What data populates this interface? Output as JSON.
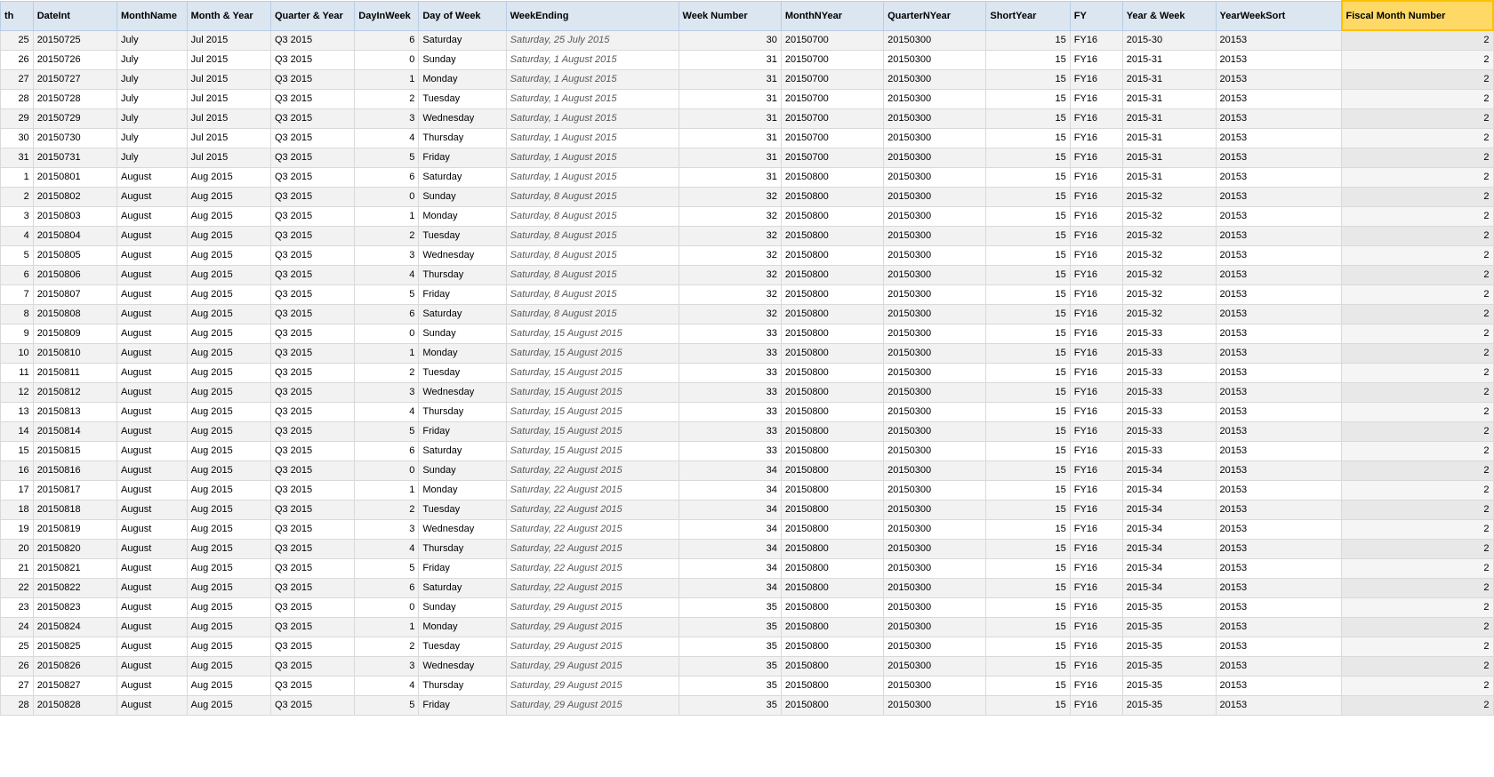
{
  "columns": [
    {
      "key": "row",
      "label": "th",
      "class": "col-row"
    },
    {
      "key": "dateint",
      "label": "DateInt",
      "class": "col-date"
    },
    {
      "key": "monthname",
      "label": "MonthName",
      "class": "col-month"
    },
    {
      "key": "monthyear",
      "label": "Month & Year",
      "class": "col-monthyear"
    },
    {
      "key": "quarteryear",
      "label": "Quarter & Year",
      "class": "col-quarter"
    },
    {
      "key": "dayinweek",
      "label": "DayInWeek",
      "class": "col-dayin"
    },
    {
      "key": "dayofweek",
      "label": "Day of Week",
      "class": "col-dow"
    },
    {
      "key": "weekending",
      "label": "WeekEnding",
      "class": "col-weekend"
    },
    {
      "key": "weeknumber",
      "label": "Week Number",
      "class": "col-weeknum"
    },
    {
      "key": "monthnyear",
      "label": "MonthNYear",
      "class": "col-monthyr"
    },
    {
      "key": "quarternyr",
      "label": "QuarterNYear",
      "class": "col-qtryr"
    },
    {
      "key": "shortyear",
      "label": "ShortYear",
      "class": "col-shortyear"
    },
    {
      "key": "fy",
      "label": "FY",
      "class": "col-fy"
    },
    {
      "key": "yearweek",
      "label": "Year & Week",
      "class": "col-yearweek"
    },
    {
      "key": "yearweeksort",
      "label": "YearWeekSort",
      "class": "col-yearweeksort"
    },
    {
      "key": "fiscalmonth",
      "label": "Fiscal Month Number",
      "class": "col-fiscalmonth",
      "highlighted": true
    }
  ],
  "rows": [
    {
      "row": 25,
      "dateint": "20150725",
      "monthname": "July",
      "monthyear": "Jul 2015",
      "quarteryear": "Q3 2015",
      "dayinweek": 6,
      "dayofweek": "Saturday",
      "weekending": "Saturday, 25 July 2015",
      "weeknumber": 30,
      "monthnyear": "20150700",
      "quarternyr": "20150300",
      "shortyear": 15,
      "fy": "FY16",
      "yearweek": "2015-30",
      "yearweeksort": "20153",
      "fiscalmonth": 2
    },
    {
      "row": 26,
      "dateint": "20150726",
      "monthname": "July",
      "monthyear": "Jul 2015",
      "quarteryear": "Q3 2015",
      "dayinweek": 0,
      "dayofweek": "Sunday",
      "weekending": "Saturday, 1 August 2015",
      "weeknumber": 31,
      "monthnyear": "20150700",
      "quarternyr": "20150300",
      "shortyear": 15,
      "fy": "FY16",
      "yearweek": "2015-31",
      "yearweeksort": "20153",
      "fiscalmonth": 2
    },
    {
      "row": 27,
      "dateint": "20150727",
      "monthname": "July",
      "monthyear": "Jul 2015",
      "quarteryear": "Q3 2015",
      "dayinweek": 1,
      "dayofweek": "Monday",
      "weekending": "Saturday, 1 August 2015",
      "weeknumber": 31,
      "monthnyear": "20150700",
      "quarternyr": "20150300",
      "shortyear": 15,
      "fy": "FY16",
      "yearweek": "2015-31",
      "yearweeksort": "20153",
      "fiscalmonth": 2
    },
    {
      "row": 28,
      "dateint": "20150728",
      "monthname": "July",
      "monthyear": "Jul 2015",
      "quarteryear": "Q3 2015",
      "dayinweek": 2,
      "dayofweek": "Tuesday",
      "weekending": "Saturday, 1 August 2015",
      "weeknumber": 31,
      "monthnyear": "20150700",
      "quarternyr": "20150300",
      "shortyear": 15,
      "fy": "FY16",
      "yearweek": "2015-31",
      "yearweeksort": "20153",
      "fiscalmonth": 2
    },
    {
      "row": 29,
      "dateint": "20150729",
      "monthname": "July",
      "monthyear": "Jul 2015",
      "quarteryear": "Q3 2015",
      "dayinweek": 3,
      "dayofweek": "Wednesday",
      "weekending": "Saturday, 1 August 2015",
      "weeknumber": 31,
      "monthnyear": "20150700",
      "quarternyr": "20150300",
      "shortyear": 15,
      "fy": "FY16",
      "yearweek": "2015-31",
      "yearweeksort": "20153",
      "fiscalmonth": 2
    },
    {
      "row": 30,
      "dateint": "20150730",
      "monthname": "July",
      "monthyear": "Jul 2015",
      "quarteryear": "Q3 2015",
      "dayinweek": 4,
      "dayofweek": "Thursday",
      "weekending": "Saturday, 1 August 2015",
      "weeknumber": 31,
      "monthnyear": "20150700",
      "quarternyr": "20150300",
      "shortyear": 15,
      "fy": "FY16",
      "yearweek": "2015-31",
      "yearweeksort": "20153",
      "fiscalmonth": 2
    },
    {
      "row": 31,
      "dateint": "20150731",
      "monthname": "July",
      "monthyear": "Jul 2015",
      "quarteryear": "Q3 2015",
      "dayinweek": 5,
      "dayofweek": "Friday",
      "weekending": "Saturday, 1 August 2015",
      "weeknumber": 31,
      "monthnyear": "20150700",
      "quarternyr": "20150300",
      "shortyear": 15,
      "fy": "FY16",
      "yearweek": "2015-31",
      "yearweeksort": "20153",
      "fiscalmonth": 2
    },
    {
      "row": 1,
      "dateint": "20150801",
      "monthname": "August",
      "monthyear": "Aug 2015",
      "quarteryear": "Q3 2015",
      "dayinweek": 6,
      "dayofweek": "Saturday",
      "weekending": "Saturday, 1 August 2015",
      "weeknumber": 31,
      "monthnyear": "20150800",
      "quarternyr": "20150300",
      "shortyear": 15,
      "fy": "FY16",
      "yearweek": "2015-31",
      "yearweeksort": "20153",
      "fiscalmonth": 2
    },
    {
      "row": 2,
      "dateint": "20150802",
      "monthname": "August",
      "monthyear": "Aug 2015",
      "quarteryear": "Q3 2015",
      "dayinweek": 0,
      "dayofweek": "Sunday",
      "weekending": "Saturday, 8 August 2015",
      "weeknumber": 32,
      "monthnyear": "20150800",
      "quarternyr": "20150300",
      "shortyear": 15,
      "fy": "FY16",
      "yearweek": "2015-32",
      "yearweeksort": "20153",
      "fiscalmonth": 2
    },
    {
      "row": 3,
      "dateint": "20150803",
      "monthname": "August",
      "monthyear": "Aug 2015",
      "quarteryear": "Q3 2015",
      "dayinweek": 1,
      "dayofweek": "Monday",
      "weekending": "Saturday, 8 August 2015",
      "weeknumber": 32,
      "monthnyear": "20150800",
      "quarternyr": "20150300",
      "shortyear": 15,
      "fy": "FY16",
      "yearweek": "2015-32",
      "yearweeksort": "20153",
      "fiscalmonth": 2
    },
    {
      "row": 4,
      "dateint": "20150804",
      "monthname": "August",
      "monthyear": "Aug 2015",
      "quarteryear": "Q3 2015",
      "dayinweek": 2,
      "dayofweek": "Tuesday",
      "weekending": "Saturday, 8 August 2015",
      "weeknumber": 32,
      "monthnyear": "20150800",
      "quarternyr": "20150300",
      "shortyear": 15,
      "fy": "FY16",
      "yearweek": "2015-32",
      "yearweeksort": "20153",
      "fiscalmonth": 2
    },
    {
      "row": 5,
      "dateint": "20150805",
      "monthname": "August",
      "monthyear": "Aug 2015",
      "quarteryear": "Q3 2015",
      "dayinweek": 3,
      "dayofweek": "Wednesday",
      "weekending": "Saturday, 8 August 2015",
      "weeknumber": 32,
      "monthnyear": "20150800",
      "quarternyr": "20150300",
      "shortyear": 15,
      "fy": "FY16",
      "yearweek": "2015-32",
      "yearweeksort": "20153",
      "fiscalmonth": 2
    },
    {
      "row": 6,
      "dateint": "20150806",
      "monthname": "August",
      "monthyear": "Aug 2015",
      "quarteryear": "Q3 2015",
      "dayinweek": 4,
      "dayofweek": "Thursday",
      "weekending": "Saturday, 8 August 2015",
      "weeknumber": 32,
      "monthnyear": "20150800",
      "quarternyr": "20150300",
      "shortyear": 15,
      "fy": "FY16",
      "yearweek": "2015-32",
      "yearweeksort": "20153",
      "fiscalmonth": 2
    },
    {
      "row": 7,
      "dateint": "20150807",
      "monthname": "August",
      "monthyear": "Aug 2015",
      "quarteryear": "Q3 2015",
      "dayinweek": 5,
      "dayofweek": "Friday",
      "weekending": "Saturday, 8 August 2015",
      "weeknumber": 32,
      "monthnyear": "20150800",
      "quarternyr": "20150300",
      "shortyear": 15,
      "fy": "FY16",
      "yearweek": "2015-32",
      "yearweeksort": "20153",
      "fiscalmonth": 2
    },
    {
      "row": 8,
      "dateint": "20150808",
      "monthname": "August",
      "monthyear": "Aug 2015",
      "quarteryear": "Q3 2015",
      "dayinweek": 6,
      "dayofweek": "Saturday",
      "weekending": "Saturday, 8 August 2015",
      "weeknumber": 32,
      "monthnyear": "20150800",
      "quarternyr": "20150300",
      "shortyear": 15,
      "fy": "FY16",
      "yearweek": "2015-32",
      "yearweeksort": "20153",
      "fiscalmonth": 2
    },
    {
      "row": 9,
      "dateint": "20150809",
      "monthname": "August",
      "monthyear": "Aug 2015",
      "quarteryear": "Q3 2015",
      "dayinweek": 0,
      "dayofweek": "Sunday",
      "weekending": "Saturday, 15 August 2015",
      "weeknumber": 33,
      "monthnyear": "20150800",
      "quarternyr": "20150300",
      "shortyear": 15,
      "fy": "FY16",
      "yearweek": "2015-33",
      "yearweeksort": "20153",
      "fiscalmonth": 2
    },
    {
      "row": 10,
      "dateint": "20150810",
      "monthname": "August",
      "monthyear": "Aug 2015",
      "quarteryear": "Q3 2015",
      "dayinweek": 1,
      "dayofweek": "Monday",
      "weekending": "Saturday, 15 August 2015",
      "weeknumber": 33,
      "monthnyear": "20150800",
      "quarternyr": "20150300",
      "shortyear": 15,
      "fy": "FY16",
      "yearweek": "2015-33",
      "yearweeksort": "20153",
      "fiscalmonth": 2
    },
    {
      "row": 11,
      "dateint": "20150811",
      "monthname": "August",
      "monthyear": "Aug 2015",
      "quarteryear": "Q3 2015",
      "dayinweek": 2,
      "dayofweek": "Tuesday",
      "weekending": "Saturday, 15 August 2015",
      "weeknumber": 33,
      "monthnyear": "20150800",
      "quarternyr": "20150300",
      "shortyear": 15,
      "fy": "FY16",
      "yearweek": "2015-33",
      "yearweeksort": "20153",
      "fiscalmonth": 2
    },
    {
      "row": 12,
      "dateint": "20150812",
      "monthname": "August",
      "monthyear": "Aug 2015",
      "quarteryear": "Q3 2015",
      "dayinweek": 3,
      "dayofweek": "Wednesday",
      "weekending": "Saturday, 15 August 2015",
      "weeknumber": 33,
      "monthnyear": "20150800",
      "quarternyr": "20150300",
      "shortyear": 15,
      "fy": "FY16",
      "yearweek": "2015-33",
      "yearweeksort": "20153",
      "fiscalmonth": 2
    },
    {
      "row": 13,
      "dateint": "20150813",
      "monthname": "August",
      "monthyear": "Aug 2015",
      "quarteryear": "Q3 2015",
      "dayinweek": 4,
      "dayofweek": "Thursday",
      "weekending": "Saturday, 15 August 2015",
      "weeknumber": 33,
      "monthnyear": "20150800",
      "quarternyr": "20150300",
      "shortyear": 15,
      "fy": "FY16",
      "yearweek": "2015-33",
      "yearweeksort": "20153",
      "fiscalmonth": 2
    },
    {
      "row": 14,
      "dateint": "20150814",
      "monthname": "August",
      "monthyear": "Aug 2015",
      "quarteryear": "Q3 2015",
      "dayinweek": 5,
      "dayofweek": "Friday",
      "weekending": "Saturday, 15 August 2015",
      "weeknumber": 33,
      "monthnyear": "20150800",
      "quarternyr": "20150300",
      "shortyear": 15,
      "fy": "FY16",
      "yearweek": "2015-33",
      "yearweeksort": "20153",
      "fiscalmonth": 2
    },
    {
      "row": 15,
      "dateint": "20150815",
      "monthname": "August",
      "monthyear": "Aug 2015",
      "quarteryear": "Q3 2015",
      "dayinweek": 6,
      "dayofweek": "Saturday",
      "weekending": "Saturday, 15 August 2015",
      "weeknumber": 33,
      "monthnyear": "20150800",
      "quarternyr": "20150300",
      "shortyear": 15,
      "fy": "FY16",
      "yearweek": "2015-33",
      "yearweeksort": "20153",
      "fiscalmonth": 2
    },
    {
      "row": 16,
      "dateint": "20150816",
      "monthname": "August",
      "monthyear": "Aug 2015",
      "quarteryear": "Q3 2015",
      "dayinweek": 0,
      "dayofweek": "Sunday",
      "weekending": "Saturday, 22 August 2015",
      "weeknumber": 34,
      "monthnyear": "20150800",
      "quarternyr": "20150300",
      "shortyear": 15,
      "fy": "FY16",
      "yearweek": "2015-34",
      "yearweeksort": "20153",
      "fiscalmonth": 2
    },
    {
      "row": 17,
      "dateint": "20150817",
      "monthname": "August",
      "monthyear": "Aug 2015",
      "quarteryear": "Q3 2015",
      "dayinweek": 1,
      "dayofweek": "Monday",
      "weekending": "Saturday, 22 August 2015",
      "weeknumber": 34,
      "monthnyear": "20150800",
      "quarternyr": "20150300",
      "shortyear": 15,
      "fy": "FY16",
      "yearweek": "2015-34",
      "yearweeksort": "20153",
      "fiscalmonth": 2
    },
    {
      "row": 18,
      "dateint": "20150818",
      "monthname": "August",
      "monthyear": "Aug 2015",
      "quarteryear": "Q3 2015",
      "dayinweek": 2,
      "dayofweek": "Tuesday",
      "weekending": "Saturday, 22 August 2015",
      "weeknumber": 34,
      "monthnyear": "20150800",
      "quarternyr": "20150300",
      "shortyear": 15,
      "fy": "FY16",
      "yearweek": "2015-34",
      "yearweeksort": "20153",
      "fiscalmonth": 2
    },
    {
      "row": 19,
      "dateint": "20150819",
      "monthname": "August",
      "monthyear": "Aug 2015",
      "quarteryear": "Q3 2015",
      "dayinweek": 3,
      "dayofweek": "Wednesday",
      "weekending": "Saturday, 22 August 2015",
      "weeknumber": 34,
      "monthnyear": "20150800",
      "quarternyr": "20150300",
      "shortyear": 15,
      "fy": "FY16",
      "yearweek": "2015-34",
      "yearweeksort": "20153",
      "fiscalmonth": 2
    },
    {
      "row": 20,
      "dateint": "20150820",
      "monthname": "August",
      "monthyear": "Aug 2015",
      "quarteryear": "Q3 2015",
      "dayinweek": 4,
      "dayofweek": "Thursday",
      "weekending": "Saturday, 22 August 2015",
      "weeknumber": 34,
      "monthnyear": "20150800",
      "quarternyr": "20150300",
      "shortyear": 15,
      "fy": "FY16",
      "yearweek": "2015-34",
      "yearweeksort": "20153",
      "fiscalmonth": 2
    },
    {
      "row": 21,
      "dateint": "20150821",
      "monthname": "August",
      "monthyear": "Aug 2015",
      "quarteryear": "Q3 2015",
      "dayinweek": 5,
      "dayofweek": "Friday",
      "weekending": "Saturday, 22 August 2015",
      "weeknumber": 34,
      "monthnyear": "20150800",
      "quarternyr": "20150300",
      "shortyear": 15,
      "fy": "FY16",
      "yearweek": "2015-34",
      "yearweeksort": "20153",
      "fiscalmonth": 2
    },
    {
      "row": 22,
      "dateint": "20150822",
      "monthname": "August",
      "monthyear": "Aug 2015",
      "quarteryear": "Q3 2015",
      "dayinweek": 6,
      "dayofweek": "Saturday",
      "weekending": "Saturday, 22 August 2015",
      "weeknumber": 34,
      "monthnyear": "20150800",
      "quarternyr": "20150300",
      "shortyear": 15,
      "fy": "FY16",
      "yearweek": "2015-34",
      "yearweeksort": "20153",
      "fiscalmonth": 2
    },
    {
      "row": 23,
      "dateint": "20150823",
      "monthname": "August",
      "monthyear": "Aug 2015",
      "quarteryear": "Q3 2015",
      "dayinweek": 0,
      "dayofweek": "Sunday",
      "weekending": "Saturday, 29 August 2015",
      "weeknumber": 35,
      "monthnyear": "20150800",
      "quarternyr": "20150300",
      "shortyear": 15,
      "fy": "FY16",
      "yearweek": "2015-35",
      "yearweeksort": "20153",
      "fiscalmonth": 2
    },
    {
      "row": 24,
      "dateint": "20150824",
      "monthname": "August",
      "monthyear": "Aug 2015",
      "quarteryear": "Q3 2015",
      "dayinweek": 1,
      "dayofweek": "Monday",
      "weekending": "Saturday, 29 August 2015",
      "weeknumber": 35,
      "monthnyear": "20150800",
      "quarternyr": "20150300",
      "shortyear": 15,
      "fy": "FY16",
      "yearweek": "2015-35",
      "yearweeksort": "20153",
      "fiscalmonth": 2
    },
    {
      "row": 25,
      "dateint": "20150825",
      "monthname": "August",
      "monthyear": "Aug 2015",
      "quarteryear": "Q3 2015",
      "dayinweek": 2,
      "dayofweek": "Tuesday",
      "weekending": "Saturday, 29 August 2015",
      "weeknumber": 35,
      "monthnyear": "20150800",
      "quarternyr": "20150300",
      "shortyear": 15,
      "fy": "FY16",
      "yearweek": "2015-35",
      "yearweeksort": "20153",
      "fiscalmonth": 2
    },
    {
      "row": 26,
      "dateint": "20150826",
      "monthname": "August",
      "monthyear": "Aug 2015",
      "quarteryear": "Q3 2015",
      "dayinweek": 3,
      "dayofweek": "Wednesday",
      "weekending": "Saturday, 29 August 2015",
      "weeknumber": 35,
      "monthnyear": "20150800",
      "quarternyr": "20150300",
      "shortyear": 15,
      "fy": "FY16",
      "yearweek": "2015-35",
      "yearweeksort": "20153",
      "fiscalmonth": 2
    },
    {
      "row": 27,
      "dateint": "20150827",
      "monthname": "August",
      "monthyear": "Aug 2015",
      "quarteryear": "Q3 2015",
      "dayinweek": 4,
      "dayofweek": "Thursday",
      "weekending": "Saturday, 29 August 2015",
      "weeknumber": 35,
      "monthnyear": "20150800",
      "quarternyr": "20150300",
      "shortyear": 15,
      "fy": "FY16",
      "yearweek": "2015-35",
      "yearweeksort": "20153",
      "fiscalmonth": 2
    },
    {
      "row": 28,
      "dateint": "20150828",
      "monthname": "August",
      "monthyear": "Aug 2015",
      "quarteryear": "Q3 2015",
      "dayinweek": 5,
      "dayofweek": "Friday",
      "weekending": "Saturday, 29 August 2015",
      "weeknumber": 35,
      "monthnyear": "20150800",
      "quarternyr": "20150300",
      "shortyear": 15,
      "fy": "FY16",
      "yearweek": "2015-35",
      "yearweeksort": "20153",
      "fiscalmonth": 2
    }
  ]
}
